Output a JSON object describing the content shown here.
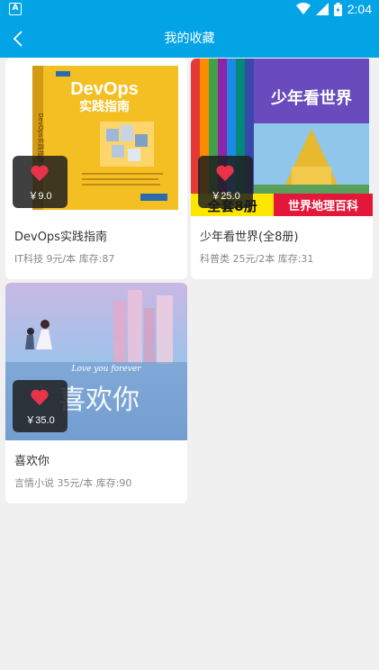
{
  "status_bar": {
    "time": "2:04",
    "left_icon_label": "A"
  },
  "app_bar": {
    "title": "我的收藏"
  },
  "books": [
    {
      "title": "DevOps实践指南",
      "price": "￥9.0",
      "category": "IT科技",
      "unit_price": "9元/本",
      "stock_label": "库存:",
      "stock": "87",
      "cover": {
        "heading": "DevOps",
        "subheading": "实践指南",
        "spine": "DevOps实践指南",
        "bg": "#f4bf22"
      }
    },
    {
      "title": "少年看世界(全8册)",
      "price": "￥25.0",
      "category": "科普类",
      "unit_price": "25元/2本",
      "stock_label": "库存:",
      "stock": "31",
      "cover": {
        "heading": "少年看世界",
        "banner_left": "全套8册",
        "banner_right": "世界地理百科",
        "bg": "#e8f1f9"
      }
    },
    {
      "title": "喜欢你",
      "price": "￥35.0",
      "category": "言情小说",
      "unit_price": "35元/本",
      "stock_label": "库存:",
      "stock": "90",
      "cover": {
        "heading": "喜欢你",
        "script": "Love you forever",
        "bg": "#b9c9e6"
      }
    }
  ],
  "colors": {
    "primary": "#03a4e6",
    "heart": "#e8334a",
    "page_bg": "#f0f0f0"
  }
}
